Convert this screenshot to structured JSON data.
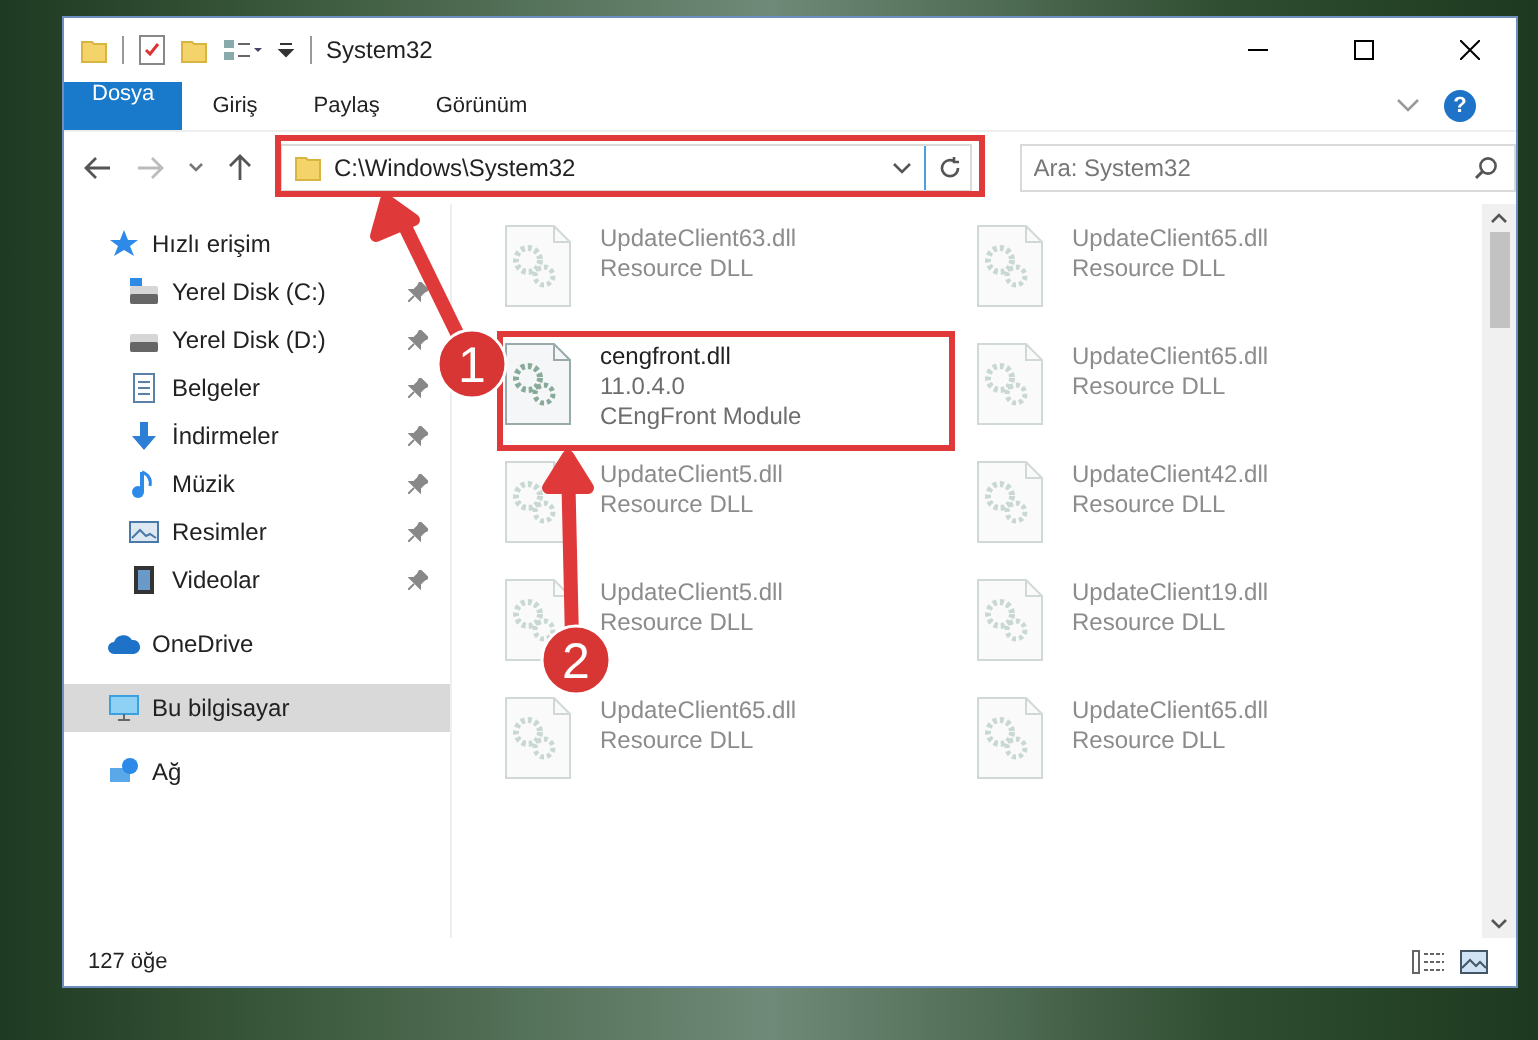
{
  "window": {
    "title": "System32"
  },
  "ribbon_tabs": [
    {
      "label": "Dosya",
      "kind": "file",
      "selected": false
    },
    {
      "label": "Giriş",
      "kind": "tab",
      "selected": false
    },
    {
      "label": "Paylaş",
      "kind": "tab",
      "selected": false
    },
    {
      "label": "Görünüm",
      "kind": "tab",
      "selected": false
    }
  ],
  "address_bar": {
    "path": "C:\\Windows\\System32"
  },
  "help_button": {
    "label": "?"
  },
  "search": {
    "placeholder": "Ara: System32"
  },
  "navigation": [
    {
      "label": "Hızlı erişim",
      "kind": "star",
      "selected": false,
      "children": [
        {
          "label": "Yerel Disk (C:)",
          "kind": "windows-drive",
          "pinned": true,
          "selected": false
        },
        {
          "label": "Yerel Disk (D:)",
          "kind": "drive",
          "pinned": true,
          "selected": false
        },
        {
          "label": "Belgeler",
          "kind": "documents",
          "pinned": true,
          "selected": false
        },
        {
          "label": "İndirmeler",
          "kind": "downloads",
          "pinned": true,
          "selected": false
        },
        {
          "label": "Müzik",
          "kind": "music",
          "pinned": true,
          "selected": false
        },
        {
          "label": "Resimler",
          "kind": "pictures",
          "pinned": true,
          "selected": false
        },
        {
          "label": "Videolar",
          "kind": "videos",
          "pinned": true,
          "selected": false
        }
      ]
    },
    {
      "label": "OneDrive",
      "kind": "cloud",
      "selected": false
    },
    {
      "label": "Bu bilgisayar",
      "kind": "computer",
      "selected": true
    },
    {
      "label": "Ağ",
      "kind": "network",
      "selected": false
    }
  ],
  "files": [
    {
      "name": "UpdateClient63.dll",
      "lines": [
        "Resource DLL"
      ],
      "blurred": true
    },
    {
      "name": "UpdateClient65.dll",
      "lines": [
        "Resource DLL"
      ],
      "blurred": true
    },
    {
      "name": "cengfront.dll",
      "lines": [
        "11.0.4.0",
        "CEngFront Module"
      ],
      "blurred": false
    },
    {
      "name": "UpdateClient65.dll",
      "lines": [
        "Resource DLL"
      ],
      "blurred": true
    },
    {
      "name": "UpdateClient5.dll",
      "lines": [
        "Resource DLL"
      ],
      "blurred": true
    },
    {
      "name": "UpdateClient42.dll",
      "lines": [
        "Resource DLL"
      ],
      "blurred": true
    },
    {
      "name": "UpdateClient5.dll",
      "lines": [
        "Resource DLL"
      ],
      "blurred": true
    },
    {
      "name": "UpdateClient19.dll",
      "lines": [
        "Resource DLL"
      ],
      "blurred": true
    },
    {
      "name": "UpdateClient65.dll",
      "lines": [
        "Resource DLL"
      ],
      "blurred": true
    },
    {
      "name": "UpdateClient65.dll",
      "lines": [
        "Resource DLL"
      ],
      "blurred": true
    }
  ],
  "status_bar": {
    "item_count": "127 öğe"
  },
  "annotations": [
    {
      "label": "1"
    },
    {
      "label": "2"
    }
  ]
}
